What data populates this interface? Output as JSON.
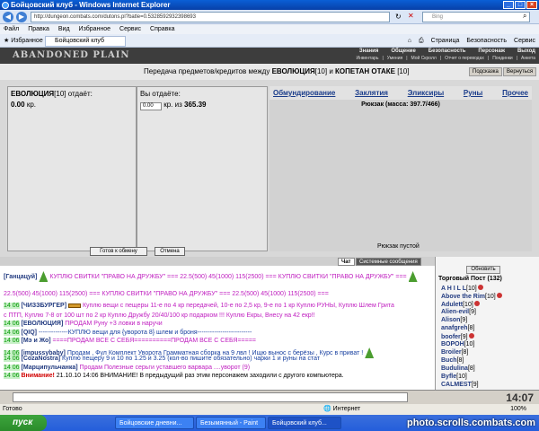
{
  "window": {
    "title": "Бойцовский клуб - Windows Internet Explorer",
    "address": "http://dungeon.combats.com/dutons.pl?batle=0.5328592932398693",
    "search_placeholder": "Bing"
  },
  "menu": [
    "Файл",
    "Правка",
    "Вид",
    "Избранное",
    "Сервис",
    "Справка"
  ],
  "favbar": {
    "favorites": "Избранное",
    "tab": "Бойцовский клуб",
    "tools": [
      "Страница",
      "Безопасность",
      "Сервис"
    ]
  },
  "game": {
    "logo": "ABANDONED PLAIN",
    "topnav": [
      "Знания",
      "Общение",
      "Безопасность",
      "Персонаж",
      "Выход"
    ],
    "subnav": [
      "Инвентарь",
      "Умения",
      "Мой Скролл",
      "Отчет о переводах",
      "Поединки",
      "Анкета"
    ],
    "transfer_prefix": "Передача предметов/кредитов между",
    "player1": "ЕВОЛЮЦИЯ",
    "player1_lvl": "[10]",
    "and": "и",
    "player2": "КОПЕТАН ОТАКЕ",
    "player2_lvl": "[10]",
    "hint_btn": "Подсказка",
    "back_btn": "Вернуться"
  },
  "trade": {
    "you_head": "ЕВОЛЮЦИЯ",
    "you_lvl": "[10]",
    "you_gives": "отдаёт:",
    "you_money": "0.00",
    "currency": "кр.",
    "me_head": "Вы отдаёте:",
    "me_money": "0.00",
    "me_of": "кр. из",
    "me_total": "365.39",
    "inv_tabs": [
      "Обмундирование",
      "Заклятия",
      "Эликсиры",
      "Руны",
      "Прочее"
    ],
    "inv_weight": "Рюкзак (масса: 397.7/466)",
    "inv_empty": "Рюкзак пустой",
    "ready_btn": "Готов к обмену",
    "cancel_btn": "Отмена"
  },
  "chat_tabs": {
    "chat": "Чат",
    "system": "Системные сообщения"
  },
  "chat": [
    {
      "time": "",
      "nick": "[Ганцацуй]",
      "text": "КУПЛЮ СВИТКИ \"ПРАВО НА ДРУЖБУ\" === 22.5(500) 45(1000) 115(2500) === КУПЛЮ СВИТКИ \"ПРАВО НА ДРУЖБУ\" ==="
    },
    {
      "time": "",
      "nick": "",
      "text": "22.5(500) 45(1000) 115(2500) === КУПЛЮ СВИТКИ \"ПРАВО НА ДРУЖБУ\" === 22.5(500) 45(1000) 115(2500) ==="
    },
    {
      "time": "14 06",
      "nick": "[ЧИЗЗБУРГЕР]",
      "text": "Куплю вещи с пещеры 11-е по 4 кр передачей, 10-е по 2,5 кр, 9-е по 1 кр Куплю РУНЫ, Куплю Шлем Грита"
    },
    {
      "time": "",
      "nick": "",
      "text": "с ПТП, Куплю 7-8 от 100 шт по 2 кр Куплю Дружбу 20/40/100 кр подарком !!! Куплю Екры, Внесу на 42 екр!!"
    },
    {
      "time": "14 06",
      "nick": "[ЕВОЛЮЦИЯ]",
      "text": "ПРОДАМ Руну +3 ловки в наручи"
    },
    {
      "time": "14 06",
      "nick": "[QIQ]",
      "text": "--------------КУПЛЮ вещи для {уворота 8} шлем и броня--------------------------"
    },
    {
      "time": "14 06",
      "nick": "[Мэ и Жо]",
      "text": "====ПРОДАМ ВСЕ С СЕБЯ==========ПРОДАМ ВСЕ С СЕБЯ====="
    },
    {
      "time": "14 06",
      "nick": "[impussybaby]",
      "text": "Продам , Фул Комплект Уворота Грамматная сборка на 9 лвл ! Ищю вынос с берёзы , Курс в приват !"
    },
    {
      "time": "14 06",
      "nick": "[CozaNostra]",
      "text": "Куплю пещеру 9 и 10 по 1.25 и 3.25 (кол-во пишите обязательно) чарки 1 и руны на стат"
    },
    {
      "time": "14 06",
      "nick": "[Марципульчанка]",
      "text": "Продам Полезные серьги уставшего варвара ....уворот (9)"
    },
    {
      "time": "14 06",
      "nick": "Внимание!",
      "text": "21.10.10 14:06 ВНИМАНИЕ! В предыдущий раз этим персонажем заходили с другого компьютера."
    }
  ],
  "online": {
    "refresh_btn": "Обновить",
    "room": "Торговый Пост (132)",
    "users": [
      {
        "name": "A H I L L",
        "lvl": "[10]"
      },
      {
        "name": "Above the Rim",
        "lvl": "[10]"
      },
      {
        "name": "Adulett",
        "lvl": "[10]"
      },
      {
        "name": "Alien-evil",
        "lvl": "[9]"
      },
      {
        "name": "Alison",
        "lvl": "[9]"
      },
      {
        "name": "anafgreh",
        "lvl": "[8]"
      },
      {
        "name": "boofer",
        "lvl": "[9]"
      },
      {
        "name": "BOPOH",
        "lvl": "[10]"
      },
      {
        "name": "Broiler",
        "lvl": "[8]"
      },
      {
        "name": "Buch",
        "lvl": "[8]"
      },
      {
        "name": "Budulina",
        "lvl": "[8]"
      },
      {
        "name": "Byfle",
        "lvl": "[10]"
      },
      {
        "name": "CALMEST",
        "lvl": "[9]"
      }
    ]
  },
  "clock": "14:07",
  "status": {
    "left": "Готово",
    "zone": "Интернет",
    "zoom": "100%"
  },
  "taskbar": {
    "start": "пуск",
    "tasks": [
      "Бойцовские дневни...",
      "Безымянный - Paint",
      "Бойцовский клуб..."
    ]
  },
  "watermark": "photo.scrolls.combats.com"
}
